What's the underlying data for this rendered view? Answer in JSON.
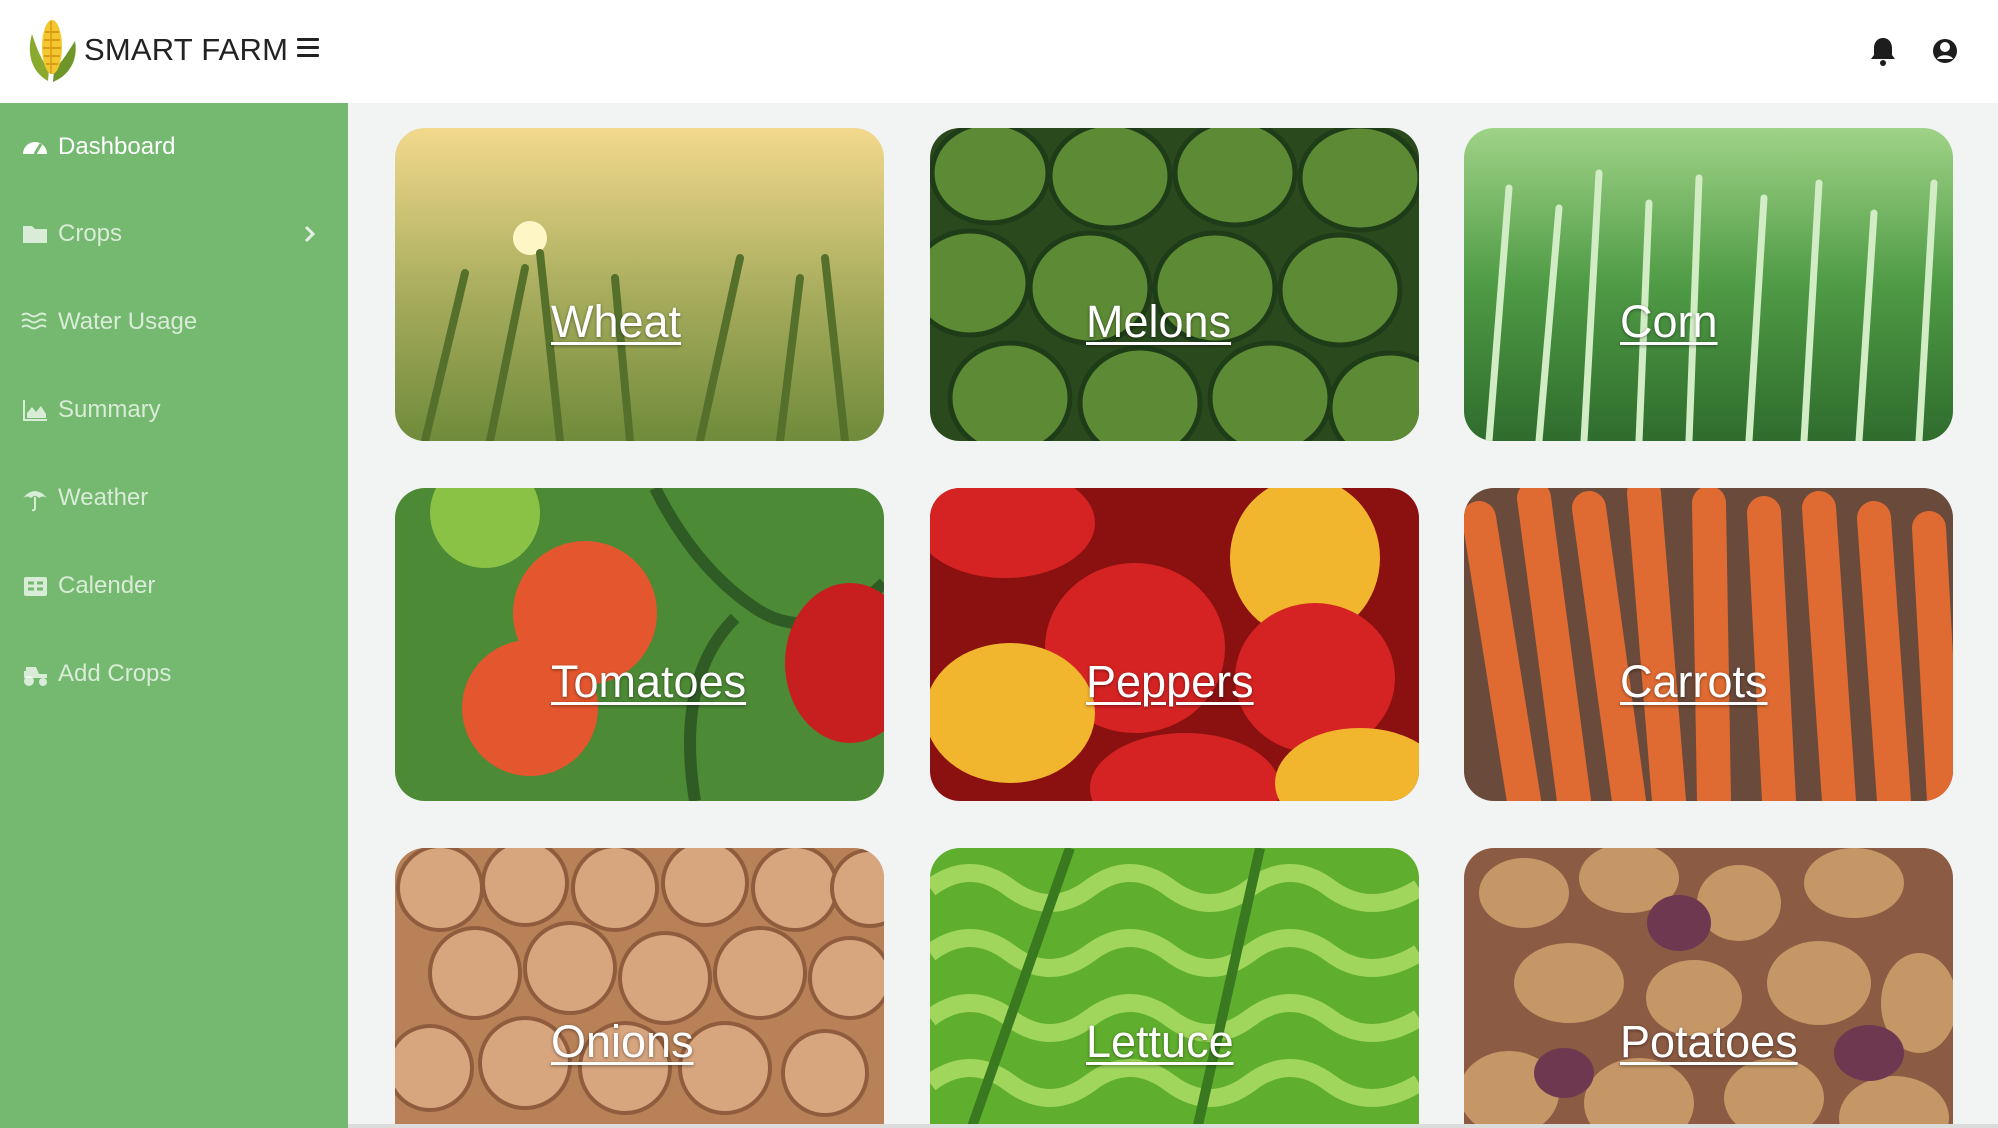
{
  "app": {
    "title": "SMART FARM",
    "logo_icon": "corn-logo-icon",
    "menu_icon": "hamburger-icon"
  },
  "topbar": {
    "icons": [
      "bell-icon",
      "user-circle-icon"
    ]
  },
  "sidebar": {
    "background": "#74b96f",
    "items": [
      {
        "label": "Dashboard",
        "icon": "speedometer-icon",
        "active": true
      },
      {
        "label": "Crops",
        "icon": "folder-icon",
        "has_submenu": true
      },
      {
        "label": "Water Usage",
        "icon": "water-icon"
      },
      {
        "label": "Summary",
        "icon": "area-chart-icon"
      },
      {
        "label": "Weather",
        "icon": "umbrella-icon"
      },
      {
        "label": "Calender",
        "icon": "table-icon"
      },
      {
        "label": "Add Crops",
        "icon": "tractor-icon"
      }
    ]
  },
  "crops": [
    {
      "name": "Wheat",
      "colors": [
        "#f3d98d",
        "#a5ab5b",
        "#6f8b3b"
      ]
    },
    {
      "name": "Melons",
      "colors": [
        "#355f24",
        "#5c8a35",
        "#1d3c17"
      ]
    },
    {
      "name": "Corn",
      "colors": [
        "#7fbf6a",
        "#4f9b45",
        "#2f6c2d"
      ]
    },
    {
      "name": "Tomatoes",
      "colors": [
        "#4c8a35",
        "#e4572e",
        "#2f5b25"
      ]
    },
    {
      "name": "Peppers",
      "colors": [
        "#d52323",
        "#f2b62e",
        "#8b1111"
      ]
    },
    {
      "name": "Carrots",
      "colors": [
        "#e06b32",
        "#b4501f",
        "#6a4a3a"
      ]
    },
    {
      "name": "Onions",
      "colors": [
        "#d7a57e",
        "#b88157",
        "#ead1bb"
      ]
    },
    {
      "name": "Lettuce",
      "colors": [
        "#9fd65b",
        "#5fae2d",
        "#397a20"
      ]
    },
    {
      "name": "Potatoes",
      "colors": [
        "#c59666",
        "#8c5b43",
        "#d6ae7a"
      ]
    }
  ]
}
